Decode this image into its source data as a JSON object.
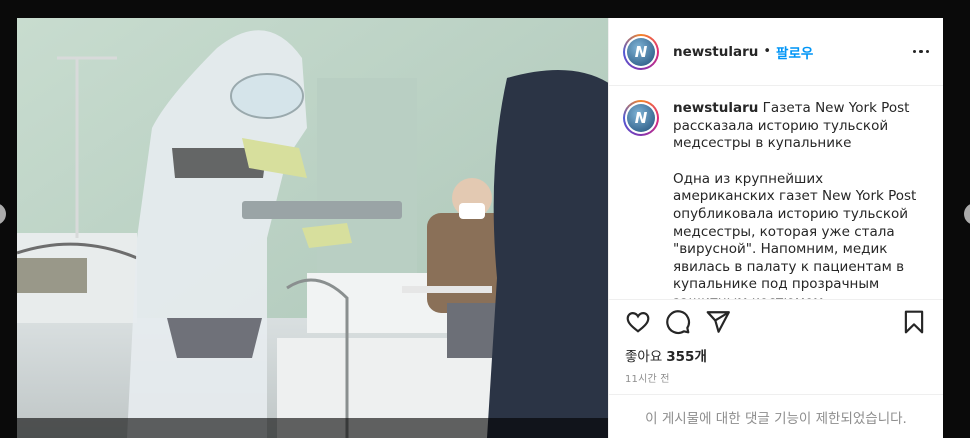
{
  "post": {
    "author": "newstularu",
    "follow_label": "팔로우",
    "separator": "•",
    "avatar_logo": "N",
    "caption_user": "newstularu",
    "caption_title": "Газета New York Post рассказала историю тульской медсестры в купальнике",
    "caption_body": "Одна из крупнейших американских газет New York Post опубликовала историю тульской медсестры, которая уже стала \"вирусной\". Напомним, медик явилась в палату к пациентам в купальнике под прозрачным защитным костюмом.",
    "likes_prefix": "좋아요",
    "likes_count": "355개",
    "timestamp": "11시간 전",
    "comments_disabled": "이 게시물에 대한 댓글 기능이 제한되었습니다."
  },
  "icons": {
    "like": "heart-icon",
    "comment": "comment-icon",
    "share": "paper-plane-icon",
    "save": "bookmark-icon",
    "more": "more-options-icon"
  },
  "colors": {
    "link_blue": "#0095f6",
    "text": "#262626",
    "muted": "#8e8e8e",
    "divider": "#efefef"
  }
}
